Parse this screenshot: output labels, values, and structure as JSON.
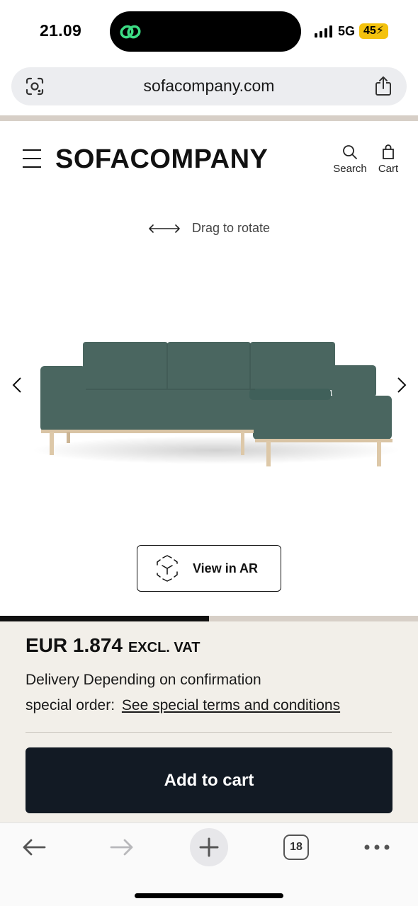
{
  "status_bar": {
    "time": "21.09",
    "network": "5G",
    "battery": "45"
  },
  "browser": {
    "url": "sofacompany.com",
    "tab_count": "18"
  },
  "header": {
    "logo": "SOFACOMPANY",
    "search_label": "Search",
    "cart_label": "Cart"
  },
  "viewer": {
    "rotate_hint": "Drag to rotate",
    "ar_button_label": "View in AR",
    "image_progress": 0.5,
    "sofa_color": "#4a6660"
  },
  "product": {
    "price": "EUR 1.874",
    "vat_note": "EXCL. VAT",
    "delivery_text": "Delivery Depending on confirmation",
    "order_label": "special order:",
    "terms_link": "See special terms and conditions",
    "add_to_cart_label": "Add to cart"
  },
  "colors": {
    "accent_dark": "#121a24",
    "panel_bg": "#f2efe9",
    "divider": "#d7cfc7",
    "battery_badge": "#f4c20d"
  }
}
